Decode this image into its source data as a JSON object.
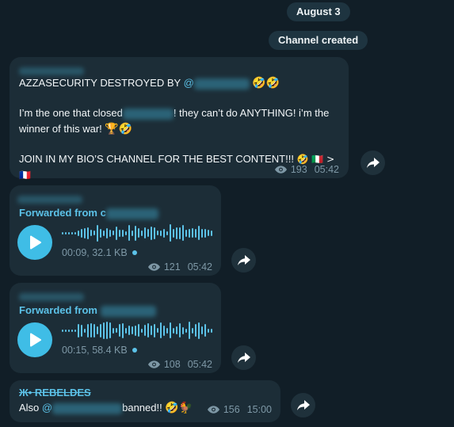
{
  "service_messages": {
    "date": "August 3",
    "channel_created": "Channel created"
  },
  "messages": [
    {
      "type": "text",
      "line1_prefix": "AZZASECURITY DESTROYED BY ",
      "line1_mention": "@",
      "line1_emoji": "🤣🤣",
      "line2_prefix": "I’m the one that closed",
      "line2_suffix": "! they can’t do ANYTHING! i’m the",
      "line3": "winner of this war! ",
      "line3_emoji": "🏆🤣",
      "line4": "JOIN IN MY BIO’S CHANNEL FOR THE BEST CONTENT!!! ",
      "line4_emoji": "🤣 🇮🇹 > 🇫🇷",
      "views": "193",
      "time": "05:42"
    },
    {
      "type": "voice",
      "forwarded_label": "Forwarded from ",
      "forwarded_prefix": "c",
      "duration_size": "00:09, 32.1 KB",
      "views": "121",
      "time": "05:42"
    },
    {
      "type": "voice",
      "forwarded_label": "Forwarded from ",
      "forwarded_prefix": "",
      "duration_size": "00:15, 58.4 KB",
      "views": "108",
      "time": "05:42"
    },
    {
      "type": "text",
      "sender": "Ж• REBELDES",
      "prefix": "Also ",
      "mention": "@",
      "suffix": "banned!! ",
      "emoji": "🤣🐓",
      "views": "156",
      "time": "15:00"
    }
  ],
  "icons": {
    "views": "eye-icon",
    "forward": "share-arrow-icon",
    "play": "play-icon",
    "unread": "unread-dot-icon"
  },
  "colors": {
    "background": "#111e27",
    "bubble": "#1c2d37",
    "accent": "#5cc2e8",
    "play_button": "#3fbde6",
    "meta_text": "#7e98a6"
  }
}
